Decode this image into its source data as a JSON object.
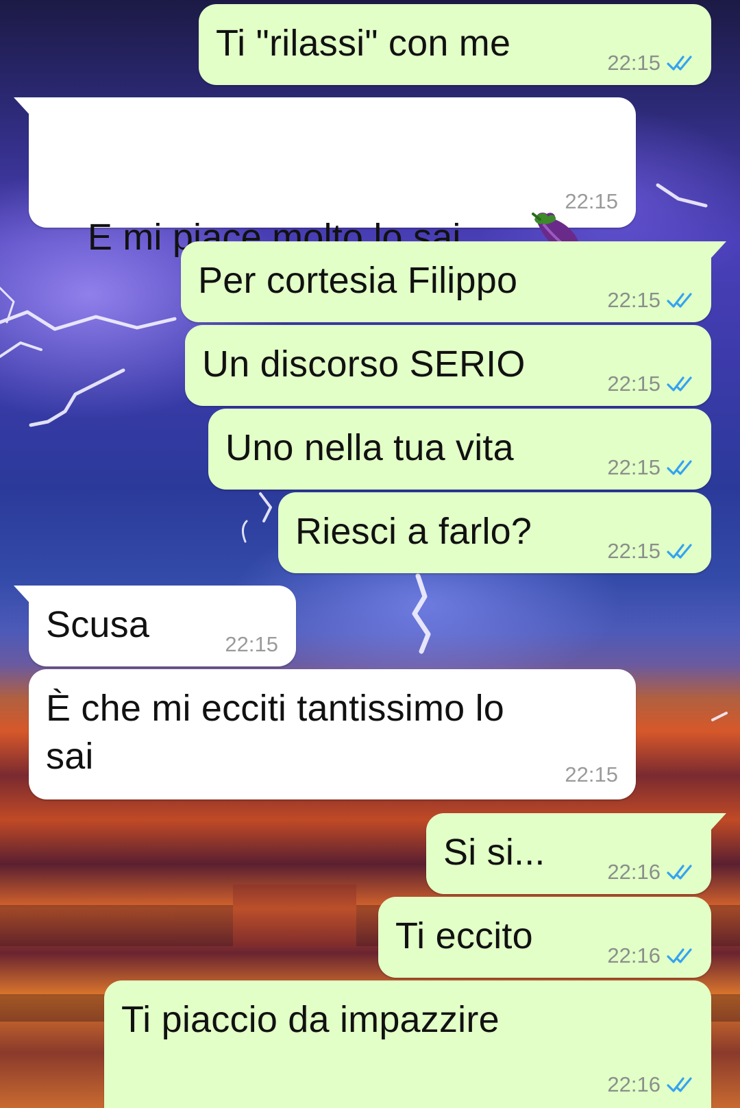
{
  "messages": [
    {
      "dir": "out",
      "text": "Ti \"rilassi\" con me",
      "time": "22:15",
      "read": true
    },
    {
      "dir": "in",
      "text": "E mi piace molto lo sai",
      "emoji": "eggplant-icon",
      "time": "22:15"
    },
    {
      "dir": "out",
      "text": "Per cortesia Filippo",
      "time": "22:15",
      "read": true
    },
    {
      "dir": "out",
      "text": "Un discorso SERIO",
      "time": "22:15",
      "read": true
    },
    {
      "dir": "out",
      "text": "Uno nella tua vita",
      "time": "22:15",
      "read": true
    },
    {
      "dir": "out",
      "text": "Riesci a farlo?",
      "time": "22:15",
      "read": true
    },
    {
      "dir": "in",
      "text": "Scusa",
      "time": "22:15"
    },
    {
      "dir": "in",
      "text": "È che mi ecciti tantissimo lo\nsai",
      "time": "22:15"
    },
    {
      "dir": "out",
      "text": "Si si...",
      "time": "22:16",
      "read": true
    },
    {
      "dir": "out",
      "text": "Ti eccito",
      "time": "22:16",
      "read": true
    },
    {
      "dir": "out",
      "text": "Ti piaccio da impazzire",
      "time": "22:16",
      "read": true
    }
  ],
  "colors": {
    "outgoing_bubble": "#e2ffc7",
    "incoming_bubble": "#ffffff",
    "read_ticks": "#34a3f0",
    "timestamp": "#8a8f8a"
  }
}
